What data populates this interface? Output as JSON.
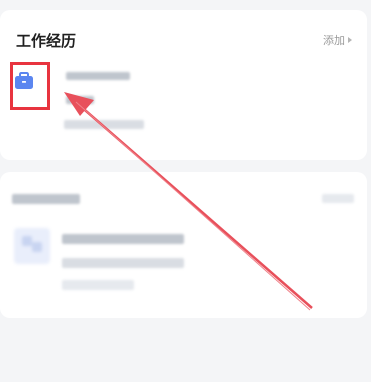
{
  "work_section": {
    "title": "工作经历",
    "add_label": "添加",
    "entry_icon": "briefcase-icon",
    "accent": "#5b86f0"
  },
  "annotation": {
    "highlight_color": "#e8343f",
    "arrow_color": "#e8505b"
  }
}
